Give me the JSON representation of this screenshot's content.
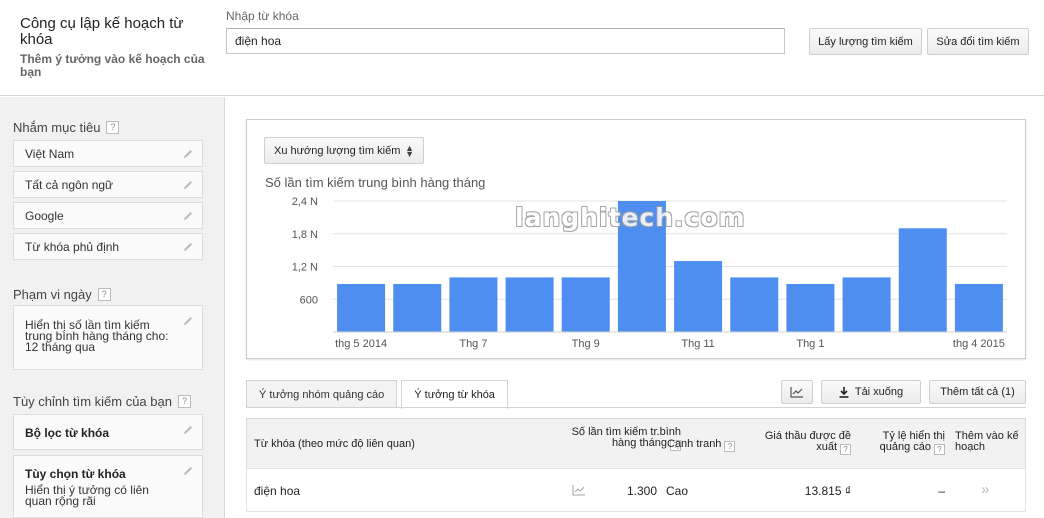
{
  "header": {
    "app_title": "Công cụ lập kế hoạch từ khóa",
    "app_subtitle": "Thêm ý tưởng vào kế hoạch của bạn",
    "keyword_label": "Nhập từ khóa",
    "keyword_value": "điện hoa",
    "get_volume_button": "Lấy lượng tìm kiếm",
    "modify_search_button": "Sửa đổi tìm kiếm"
  },
  "sidebar": {
    "targeting_title": "Nhắm mục tiêu",
    "targeting_items": [
      "Việt Nam",
      "Tất cả ngôn ngữ",
      "Google",
      "Từ khóa phủ định"
    ],
    "date_range_title": "Phạm vi ngày",
    "date_range_text": "Hiển thị số lần tìm kiếm trung bình hàng tháng cho: 12 tháng qua",
    "customize_title": "Tùy chỉnh tìm kiếm của bạn",
    "keyword_filter": "Bộ lọc từ khóa",
    "keyword_options_title": "Tùy chọn từ khóa",
    "keyword_options_desc": "Hiển thị ý tưởng có liên quan rộng rãi",
    "help_glyph": "?"
  },
  "chart_panel": {
    "selector_label": "Xu hướng lượng tìm kiếm",
    "watermark": "langhitech.com"
  },
  "chart_data": {
    "type": "bar",
    "title": "Số lần tìm kiếm trung bình hàng tháng",
    "xlabel": "",
    "ylabel": "",
    "ylim": [
      0,
      2400
    ],
    "yticks": [
      600,
      1200,
      1800,
      2400
    ],
    "ytick_labels": [
      "600",
      "1,2 N",
      "1,8 N",
      "2,4 N"
    ],
    "grid": true,
    "bar_color": "#4d8ef0",
    "categories": [
      "thg 5 2014",
      "thg 6 2014",
      "Thg 7",
      "thg 8 2014",
      "Thg 9",
      "thg 10 2014",
      "Thg 11",
      "thg 12 2014",
      "Thg 1",
      "thg 2 2015",
      "thg 3 2015",
      "thg 4 2015"
    ],
    "shown_labels": [
      "thg 5 2014",
      "",
      "Thg 7",
      "",
      "Thg 9",
      "",
      "Thg 11",
      "",
      "Thg 1",
      "",
      "",
      "thg 4 2015"
    ],
    "values": [
      880,
      880,
      1000,
      1000,
      1000,
      2400,
      1300,
      1000,
      880,
      1000,
      1900,
      880
    ]
  },
  "tabs": {
    "ad_group_ideas": "Ý tưởng nhóm quảng cáo",
    "keyword_ideas": "Ý tưởng từ khóa",
    "download_button": "Tải xuống",
    "add_all_button": "Thêm tất cả (1)"
  },
  "table": {
    "headers": {
      "keyword": "Từ khóa (theo mức độ liên quan)",
      "avg_searches": "Số lần tìm kiếm tr.bình hàng tháng",
      "competition": "Cạnh tranh",
      "suggested_bid": "Giá thầu được đề xuất",
      "ad_share": "Tỷ lệ hiển thị quảng cáo",
      "add_to_plan": "Thêm vào kế hoạch"
    },
    "rows": [
      {
        "keyword": "điện hoa",
        "avg_searches": "1.300",
        "competition": "Cao",
        "suggested_bid": "13.815 ₫",
        "ad_share": "–",
        "add_glyph": "»"
      }
    ]
  },
  "colors": {
    "bar": "#4d8ef0",
    "sidebar_bg": "#f1f1f1",
    "table_head_bg": "#f2f2f2"
  }
}
